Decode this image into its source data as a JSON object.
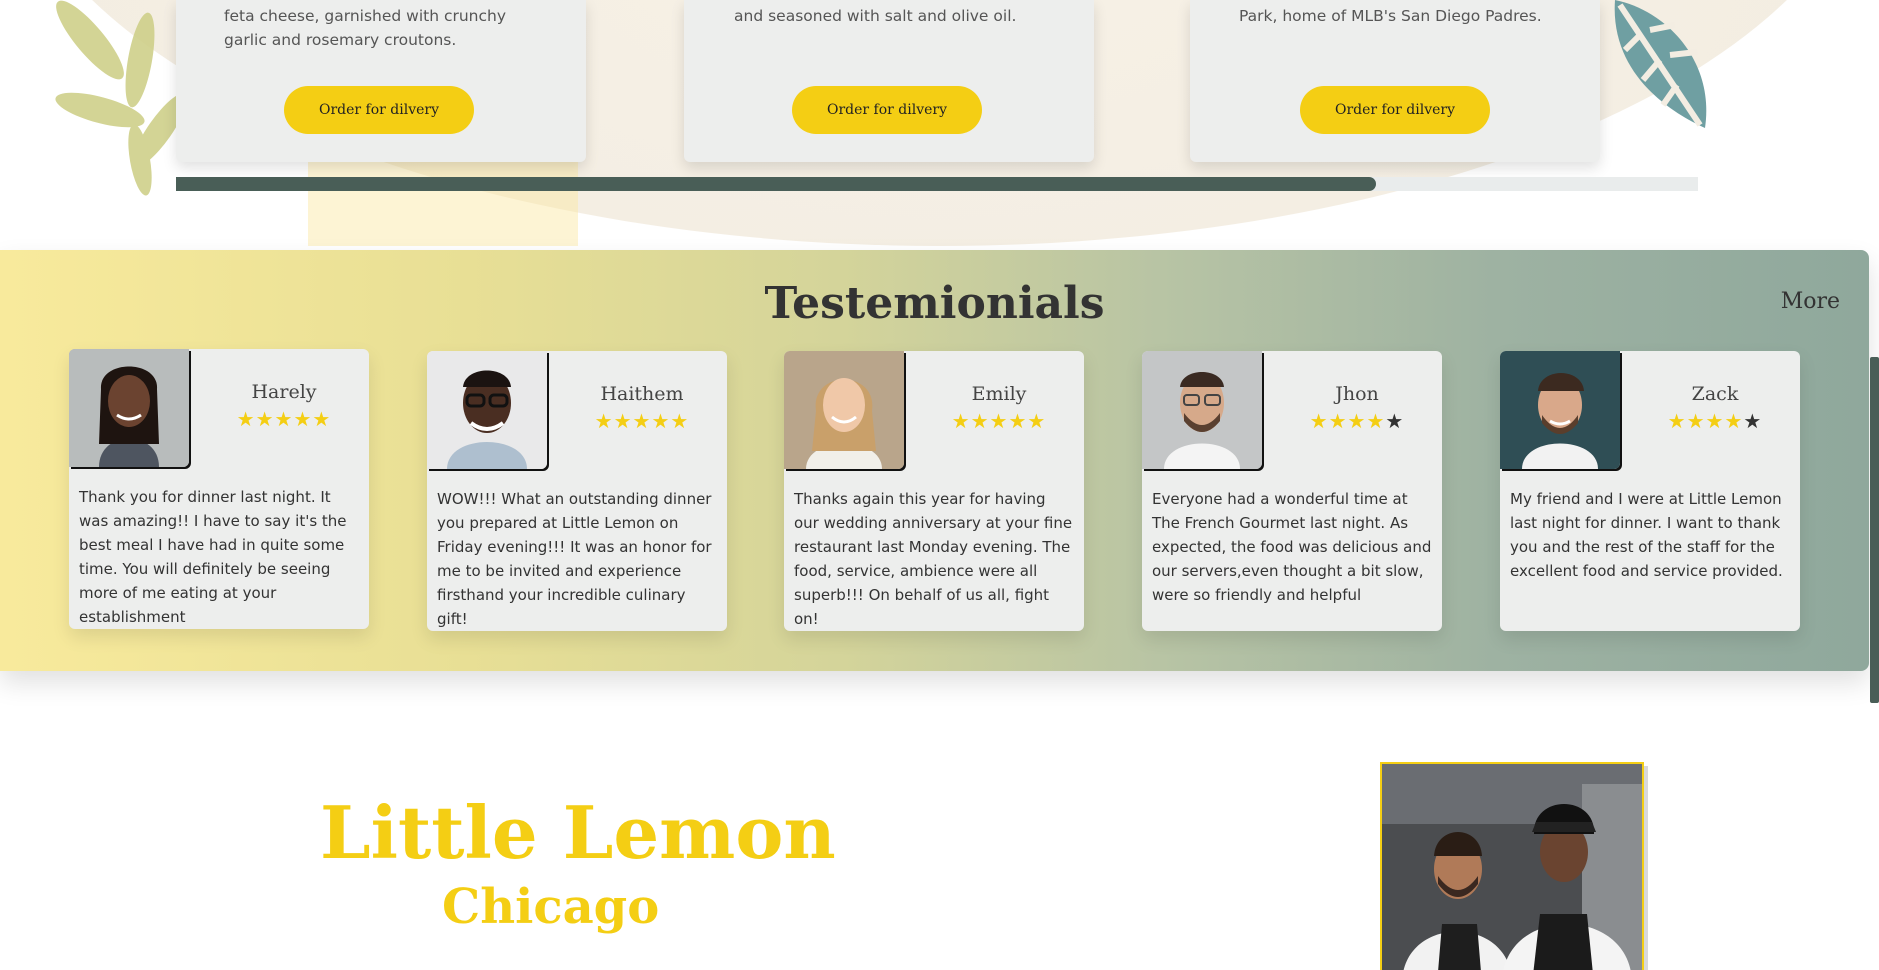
{
  "specials": {
    "cards": [
      {
        "description": "feta cheese, garnished with crunchy garlic and rosemary croutons.",
        "button": "Order for dilvery"
      },
      {
        "description": "and seasoned with salt and olive oil.",
        "button": "Order for dilvery"
      },
      {
        "description": "Park, home of MLB's San Diego Padres.",
        "button": "Order for dilvery"
      }
    ]
  },
  "testimonials": {
    "title": "Testemionials",
    "more": "More",
    "items": [
      {
        "name": "Harely",
        "stars": "★★★★★",
        "stars_off": "",
        "rating": 5,
        "text": "Thank you for dinner last night. It was amazing!! I have to say it's the best meal I have had in quite some time. You will definitely be seeing more of me eating at your establishment"
      },
      {
        "name": "Haithem",
        "stars": "★★★★★",
        "stars_off": "",
        "rating": 5,
        "text": "WOW!!! What an outstanding dinner you prepared at Little Lemon on Friday evening!!! It was an honor for me to be invited and experience firsthand your incredible culinary gift!"
      },
      {
        "name": "Emily",
        "stars": "★★★★★",
        "stars_off": "",
        "rating": 5,
        "text": "Thanks again this year for having our wedding anniversary at your fine restaurant last Monday evening. The food, service, ambience were all superb!!! On behalf of us all, fight on!"
      },
      {
        "name": "Jhon",
        "stars": "★★★★",
        "stars_off": "★",
        "rating": 4,
        "text": "Everyone had a wonderful time at The French Gourmet last night. As expected, the food was delicious and our servers,even thought a bit slow, were so friendly and helpful"
      },
      {
        "name": "Zack",
        "stars": "★★★★",
        "stars_off": "★",
        "rating": 4,
        "text": "My friend and I were at Little Lemon last night for dinner. I want to thank you and the rest of the staff for the excellent food and service provided."
      }
    ]
  },
  "about": {
    "title": "Little Lemon",
    "subtitle": "Chicago"
  },
  "colors": {
    "primary_yellow": "#f4ce14",
    "primary_green": "#495e57",
    "card_bg": "#edeeed"
  },
  "icons": {
    "star": "star-icon",
    "leaf": "leaf-icon"
  }
}
